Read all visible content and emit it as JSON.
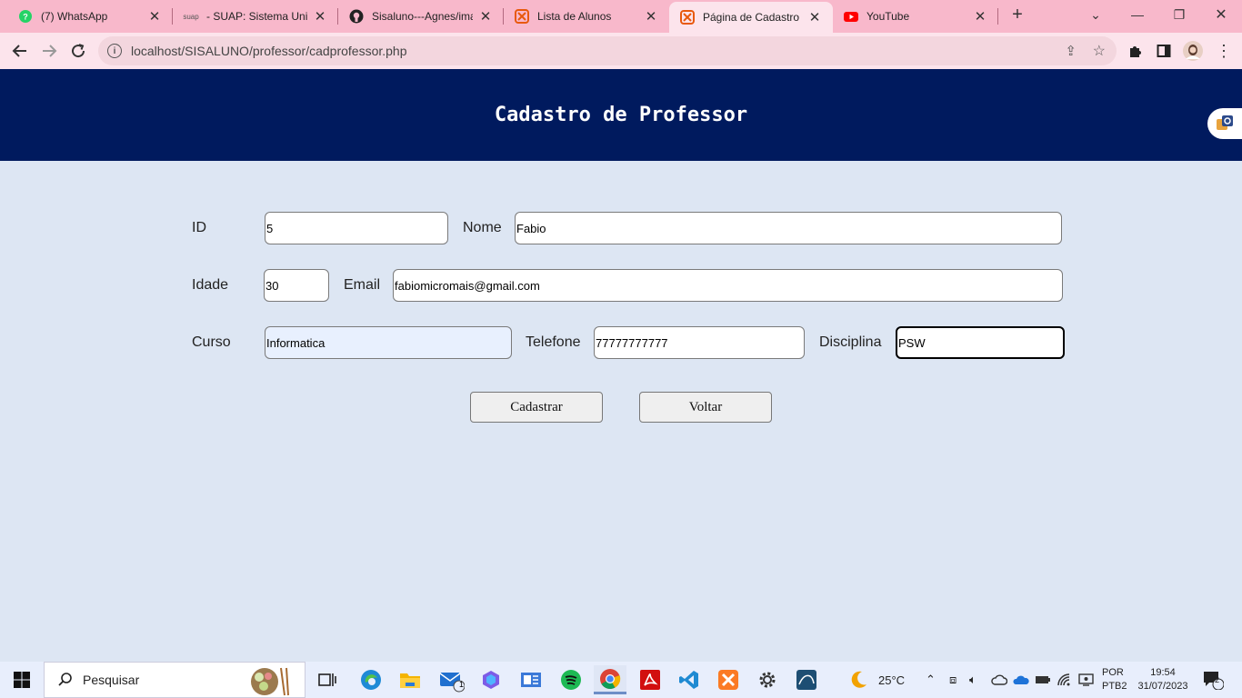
{
  "browser": {
    "tabs": [
      {
        "title": "(7) WhatsApp",
        "icon": "whatsapp-icon",
        "active": false
      },
      {
        "title": "- SUAP: Sistema Unific",
        "icon": "suap-icon",
        "icon_text": "suap",
        "active": false
      },
      {
        "title": "Sisaluno---Agnes/ima",
        "icon": "github-icon",
        "active": false
      },
      {
        "title": "Lista de Alunos",
        "icon": "xampp-icon",
        "active": false
      },
      {
        "title": "Página de Cadastro",
        "icon": "xampp-icon",
        "active": true
      },
      {
        "title": "YouTube",
        "icon": "youtube-icon",
        "active": false
      }
    ],
    "url": "localhost/SISALUNO/professor/cadprofessor.php"
  },
  "header": {
    "title": "Cadastro de Professor"
  },
  "form": {
    "id_label": "ID",
    "id_value": "5",
    "nome_label": "Nome",
    "nome_value": "Fabio",
    "idade_label": "Idade",
    "idade_value": "30",
    "email_label": "Email",
    "email_value": "fabiomicromais@gmail.com",
    "curso_label": "Curso",
    "curso_value": "Informatica",
    "telefone_label": "Telefone",
    "telefone_value": "77777777777",
    "disciplina_label": "Disciplina",
    "disciplina_value": "PSW",
    "cadastrar_label": "Cadastrar",
    "voltar_label": "Voltar"
  },
  "taskbar": {
    "search_placeholder": "Pesquisar",
    "mail_badge": "1",
    "weather": "25°C",
    "lang_line1": "POR",
    "lang_line2": "PTB2",
    "time": "19:54",
    "date": "31/07/2023",
    "notifications": "2"
  },
  "colors": {
    "tabstrip": "#f8b8cb",
    "header_bg": "#001a5e",
    "page_bg": "#dde6f3"
  }
}
